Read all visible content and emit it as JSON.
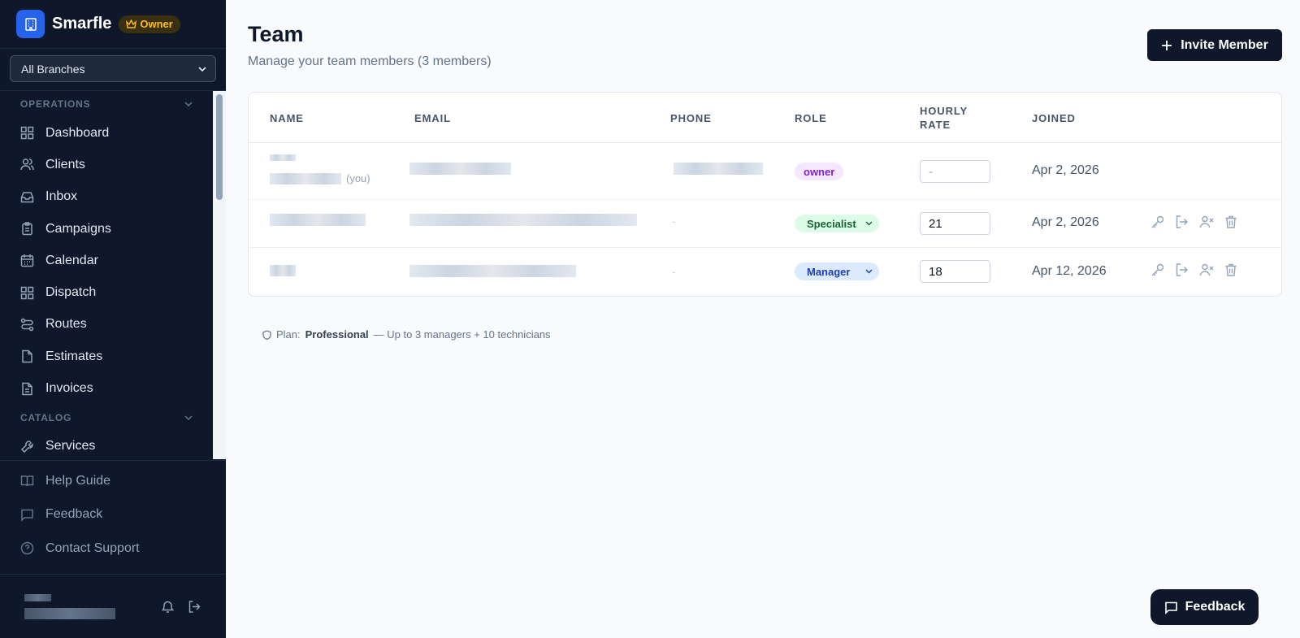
{
  "sidebar": {
    "brand": "Smarfle",
    "badge": "Owner",
    "branch_select": "All Branches",
    "sections": [
      {
        "title": "OPERATIONS",
        "items": [
          "Dashboard",
          "Clients",
          "Inbox",
          "Campaigns",
          "Calendar",
          "Dispatch",
          "Routes",
          "Estimates",
          "Invoices"
        ]
      },
      {
        "title": "CATALOG",
        "items": [
          "Services"
        ]
      }
    ],
    "footer_links": [
      "Help Guide",
      "Feedback",
      "Contact Support"
    ]
  },
  "header": {
    "title": "Team",
    "subtitle": "Manage your team members (3 members)",
    "invite_label": "Invite Member"
  },
  "table": {
    "columns": [
      "NAME",
      "EMAIL",
      "PHONE",
      "ROLE",
      "HOURLY",
      "RATE",
      "JOINED"
    ],
    "rows": [
      {
        "you_label": "(you)",
        "phone": "",
        "role": "owner",
        "rate": "-",
        "joined": "Apr 2, 2026"
      },
      {
        "you_label": "",
        "phone": "-",
        "role": "Specialist",
        "rate": "21",
        "joined": "Apr 2, 2026"
      },
      {
        "you_label": "",
        "phone": "-",
        "role": "Manager",
        "rate": "18",
        "joined": "Apr 12, 2026"
      }
    ]
  },
  "plan": {
    "prefix": "Plan:",
    "name": "Professional",
    "detail": "— Up to 3 managers + 10 technicians"
  },
  "floating_feedback": "Feedback",
  "colors": {
    "sidebar_bg": "#0f172a",
    "brand_blue": "#2563eb",
    "owner_gold": "#fbbf24"
  }
}
